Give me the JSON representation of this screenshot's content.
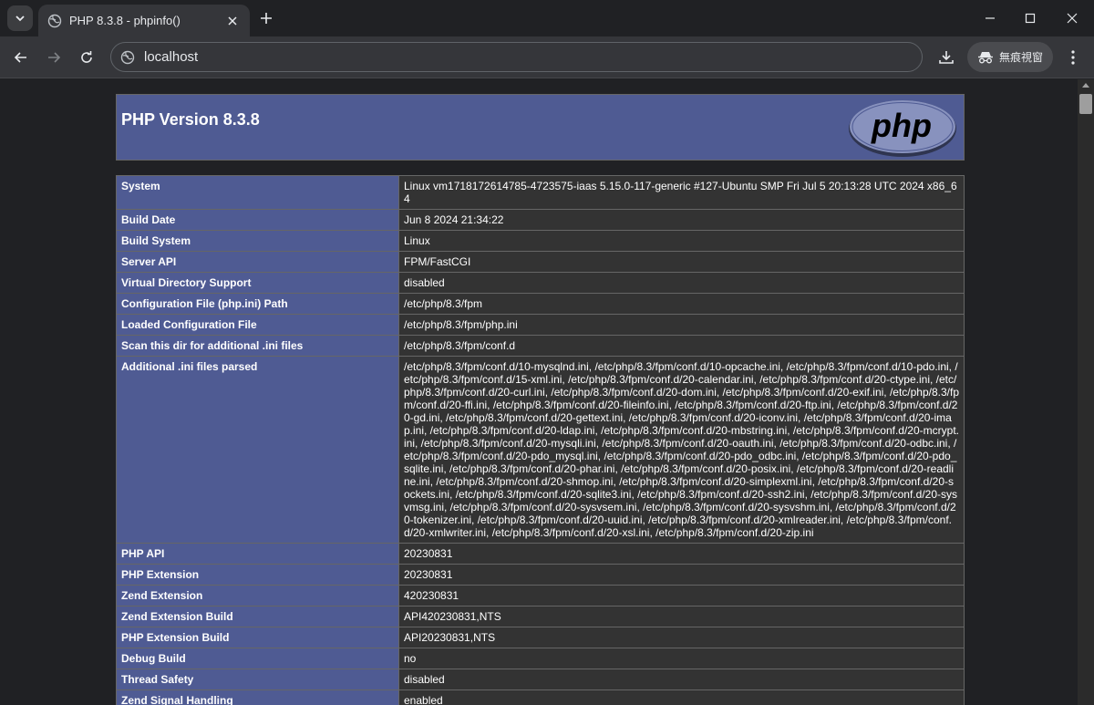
{
  "browser": {
    "tab_title": "PHP 8.3.8 - phpinfo()",
    "url": "localhost",
    "incognito_label": "無痕視窗"
  },
  "page": {
    "version_title": "PHP Version 8.3.8",
    "logo_text": "php",
    "rows": [
      {
        "key": "System",
        "value": "Linux vm1718172614785-4723575-iaas 5.15.0-117-generic #127-Ubuntu SMP Fri Jul 5 20:13:28 UTC 2024 x86_64"
      },
      {
        "key": "Build Date",
        "value": "Jun 8 2024 21:34:22"
      },
      {
        "key": "Build System",
        "value": "Linux"
      },
      {
        "key": "Server API",
        "value": "FPM/FastCGI"
      },
      {
        "key": "Virtual Directory Support",
        "value": "disabled"
      },
      {
        "key": "Configuration File (php.ini) Path",
        "value": "/etc/php/8.3/fpm"
      },
      {
        "key": "Loaded Configuration File",
        "value": "/etc/php/8.3/fpm/php.ini"
      },
      {
        "key": "Scan this dir for additional .ini files",
        "value": "/etc/php/8.3/fpm/conf.d"
      },
      {
        "key": "Additional .ini files parsed",
        "value": "/etc/php/8.3/fpm/conf.d/10-mysqlnd.ini, /etc/php/8.3/fpm/conf.d/10-opcache.ini, /etc/php/8.3/fpm/conf.d/10-pdo.ini, /etc/php/8.3/fpm/conf.d/15-xml.ini, /etc/php/8.3/fpm/conf.d/20-calendar.ini, /etc/php/8.3/fpm/conf.d/20-ctype.ini, /etc/php/8.3/fpm/conf.d/20-curl.ini, /etc/php/8.3/fpm/conf.d/20-dom.ini, /etc/php/8.3/fpm/conf.d/20-exif.ini, /etc/php/8.3/fpm/conf.d/20-ffi.ini, /etc/php/8.3/fpm/conf.d/20-fileinfo.ini, /etc/php/8.3/fpm/conf.d/20-ftp.ini, /etc/php/8.3/fpm/conf.d/20-gd.ini, /etc/php/8.3/fpm/conf.d/20-gettext.ini, /etc/php/8.3/fpm/conf.d/20-iconv.ini, /etc/php/8.3/fpm/conf.d/20-imap.ini, /etc/php/8.3/fpm/conf.d/20-ldap.ini, /etc/php/8.3/fpm/conf.d/20-mbstring.ini, /etc/php/8.3/fpm/conf.d/20-mcrypt.ini, /etc/php/8.3/fpm/conf.d/20-mysqli.ini, /etc/php/8.3/fpm/conf.d/20-oauth.ini, /etc/php/8.3/fpm/conf.d/20-odbc.ini, /etc/php/8.3/fpm/conf.d/20-pdo_mysql.ini, /etc/php/8.3/fpm/conf.d/20-pdo_odbc.ini, /etc/php/8.3/fpm/conf.d/20-pdo_sqlite.ini, /etc/php/8.3/fpm/conf.d/20-phar.ini, /etc/php/8.3/fpm/conf.d/20-posix.ini, /etc/php/8.3/fpm/conf.d/20-readline.ini, /etc/php/8.3/fpm/conf.d/20-shmop.ini, /etc/php/8.3/fpm/conf.d/20-simplexml.ini, /etc/php/8.3/fpm/conf.d/20-sockets.ini, /etc/php/8.3/fpm/conf.d/20-sqlite3.ini, /etc/php/8.3/fpm/conf.d/20-ssh2.ini, /etc/php/8.3/fpm/conf.d/20-sysvmsg.ini, /etc/php/8.3/fpm/conf.d/20-sysvsem.ini, /etc/php/8.3/fpm/conf.d/20-sysvshm.ini, /etc/php/8.3/fpm/conf.d/20-tokenizer.ini, /etc/php/8.3/fpm/conf.d/20-uuid.ini, /etc/php/8.3/fpm/conf.d/20-xmlreader.ini, /etc/php/8.3/fpm/conf.d/20-xmlwriter.ini, /etc/php/8.3/fpm/conf.d/20-xsl.ini, /etc/php/8.3/fpm/conf.d/20-zip.ini"
      },
      {
        "key": "PHP API",
        "value": "20230831"
      },
      {
        "key": "PHP Extension",
        "value": "20230831"
      },
      {
        "key": "Zend Extension",
        "value": "420230831"
      },
      {
        "key": "Zend Extension Build",
        "value": "API420230831,NTS"
      },
      {
        "key": "PHP Extension Build",
        "value": "API20230831,NTS"
      },
      {
        "key": "Debug Build",
        "value": "no"
      },
      {
        "key": "Thread Safety",
        "value": "disabled"
      },
      {
        "key": "Zend Signal Handling",
        "value": "enabled"
      }
    ]
  },
  "colors": {
    "header_bg": "#4f5b93",
    "value_bg": "#333333",
    "page_bg": "#202124"
  }
}
